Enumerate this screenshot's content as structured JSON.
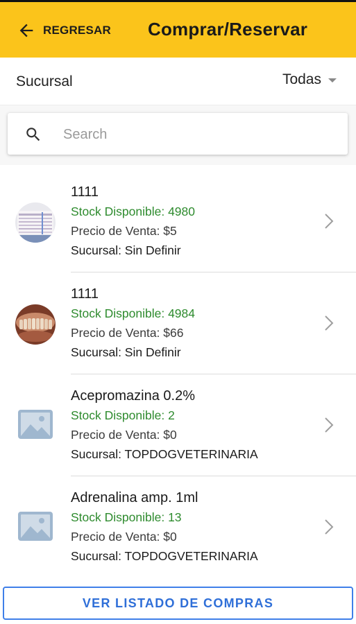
{
  "header": {
    "back_label": "REGRESAR",
    "title": "Comprar/Reservar",
    "color": "#fbc41b"
  },
  "filter": {
    "label": "Sucursal",
    "value": "Todas"
  },
  "search": {
    "placeholder": "Search",
    "value": ""
  },
  "products": [
    {
      "name": "1111",
      "stock": "Stock Disponible: 4980",
      "price": "Precio de Venta: $5",
      "branch": "Sucursal: Sin Definir",
      "image": "document-photo"
    },
    {
      "name": "1111",
      "stock": "Stock Disponible: 4984",
      "price": "Precio de Venta: $66",
      "branch": "Sucursal: Sin Definir",
      "image": "teeth-photo"
    },
    {
      "name": "Acepromazina 0.2%",
      "stock": "Stock Disponible: 2",
      "price": "Precio de Venta: $0",
      "branch": "Sucursal: TOPDOGVETERINARIA",
      "image": "image-placeholder-icon"
    },
    {
      "name": "Adrenalina amp. 1ml",
      "stock": "Stock Disponible: 13",
      "price": "Precio de Venta: $0",
      "branch": "Sucursal: TOPDOGVETERINARIA",
      "image": "image-placeholder-icon"
    }
  ],
  "footer": {
    "button_label": "VER LISTADO DE COMPRAS",
    "accent": "#3f7fe8"
  },
  "colors": {
    "stock": "#2e8b2e"
  }
}
